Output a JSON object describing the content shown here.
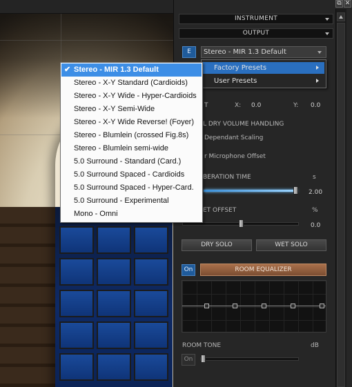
{
  "window_buttons": {
    "restore": "⧉",
    "close": "✕"
  },
  "panel": {
    "instrument_label": "INSTRUMENT",
    "output_label": "OUTPUT",
    "e_button": "E",
    "preset_value": "Stereo - MIR 1.3 Default",
    "coords": {
      "x_label": "X:",
      "x_value": "0.0",
      "y_label": "Y:",
      "y_value": "0.0",
      "t_label": "T"
    },
    "dry_volume_heading": "L DRY VOLUME HANDLING",
    "dependant_scaling": "Dependant Scaling",
    "mic_offset": "r Microphone Offset",
    "reverb_time": {
      "label": "BERATION TIME",
      "unit": "s",
      "value": "2.00",
      "level": 1.0
    },
    "wet_offset": {
      "label": "ET OFFSET",
      "unit": "%",
      "value": "0.0",
      "level": 0.5
    },
    "dry_solo": "DRY SOLO",
    "wet_solo": "WET SOLO",
    "eq_on": "On",
    "room_equalizer": "ROOM EQUALIZER",
    "room_tone": {
      "label": "ROOM TONE",
      "unit": "dB",
      "on": "On"
    }
  },
  "submenu": {
    "items": [
      {
        "label": "Factory Presets",
        "active": true
      },
      {
        "label": "User Presets",
        "active": false
      }
    ]
  },
  "menu": {
    "items": [
      {
        "label": "Stereo - MIR 1.3 Default",
        "selected": true
      },
      {
        "label": "Stereo - X-Y Standard (Cardioids)"
      },
      {
        "label": "Stereo - X-Y Wide - Hyper-Cardioids"
      },
      {
        "label": "Stereo - X-Y Semi-Wide"
      },
      {
        "label": "Stereo - X-Y Wide Reverse! (Foyer)"
      },
      {
        "label": "Stereo - Blumlein (crossed Fig.8s)"
      },
      {
        "label": "Stereo - Blumlein semi-wide"
      },
      {
        "label": "5.0 Surround - Standard (Card.)"
      },
      {
        "label": "5.0 Surround Spaced - Cardioids"
      },
      {
        "label": "5.0 Surround Spaced - Hyper-Card."
      },
      {
        "label": "5.0 Surround - Experimental"
      },
      {
        "label": "Mono - Omni"
      }
    ]
  }
}
